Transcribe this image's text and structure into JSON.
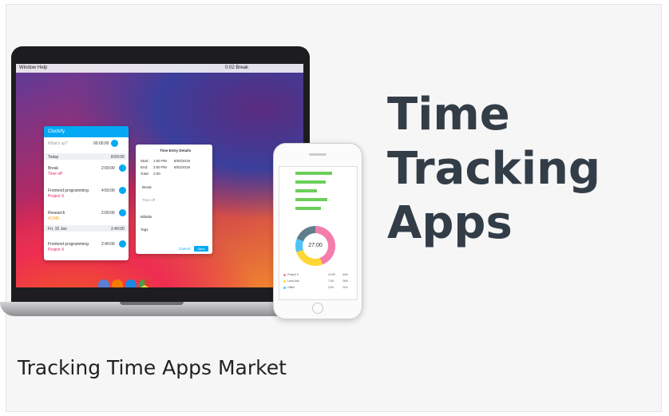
{
  "card": {
    "headline_lines": [
      "Time",
      "Tracking",
      "Apps"
    ],
    "caption": "Tracking Time Apps Market"
  },
  "laptop": {
    "menubar": {
      "left": "Window   Help",
      "right": "0:02  Break"
    },
    "clockify": {
      "title": "Clockify",
      "prompt": "What's up?",
      "timer": "00:00:00",
      "day1": "Today",
      "day1_total": "8:50:00",
      "entries": [
        {
          "name": "Break",
          "project": "Time off",
          "duration": "2:00:00"
        },
        {
          "name": "Frontend programming",
          "project": "Project X",
          "duration": "4:50:00"
        },
        {
          "name": "Research",
          "project": "ACME",
          "duration": "2:00:00"
        }
      ],
      "day2": "Fri, 15 Jan",
      "day2_total": "2:40:00",
      "entries2": [
        {
          "name": "Frontend programming",
          "project": "Project X",
          "duration": "2:40:00"
        }
      ]
    },
    "details": {
      "title": "Time Entry Details",
      "start_label": "Start:",
      "start_time": "1:00 PM",
      "start_date": "8/02/2019",
      "end_label": "End:",
      "end_time": "3:00 PM",
      "end_date": "8/02/2019",
      "total_label": "Total:",
      "total": "2:00",
      "desc": "Break",
      "project": "Time off",
      "billable": "Billable",
      "tags": "Tags",
      "cancel": "Cancel",
      "save": "Save"
    }
  },
  "phone": {
    "donut_value": "27:00",
    "legend": [
      {
        "name": "Project X",
        "value": "12:00",
        "pct": "44%",
        "color": "#f37dab"
      },
      {
        "name": "Lead Ads",
        "value": "7:00",
        "pct": "26%",
        "color": "#fdd835"
      },
      {
        "name": "Office",
        "value": "3:00",
        "pct": "11%",
        "color": "#4fc3f7"
      }
    ]
  }
}
